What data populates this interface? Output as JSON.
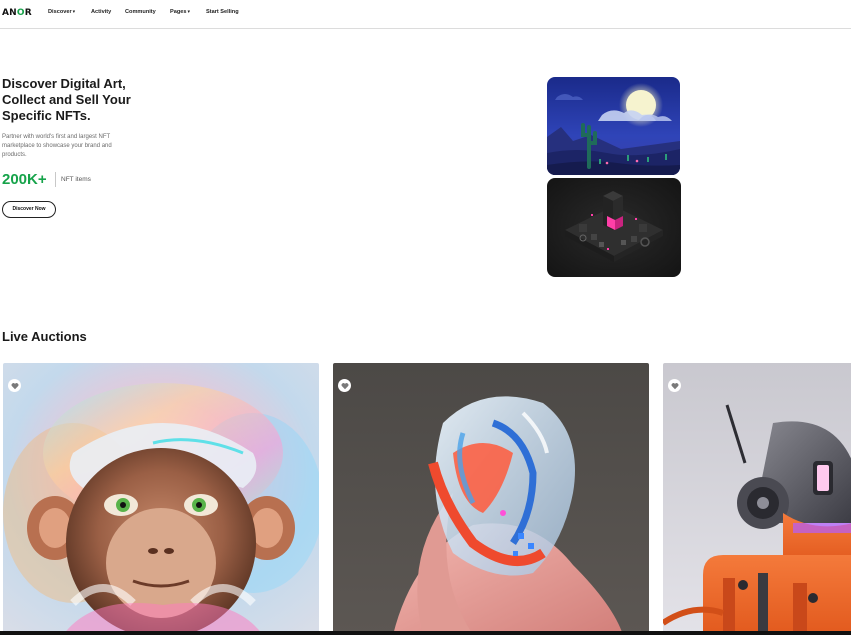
{
  "brand": {
    "logo_pre": "AN",
    "logo_o": "O",
    "logo_post": "R",
    "accent": "#16a34a"
  },
  "nav": {
    "items": [
      {
        "label": "Discover",
        "dropdown": true
      },
      {
        "label": "Activity",
        "dropdown": false
      },
      {
        "label": "Community",
        "dropdown": false
      },
      {
        "label": "Pages",
        "dropdown": true
      },
      {
        "label": "Start Selling",
        "dropdown": false
      }
    ]
  },
  "hero": {
    "title": "Discover Digital Art, Collect and Sell Your Specific NFTs.",
    "description": "Partner with world's first and largest NFT marketplace to showcase your brand and products.",
    "stat_value": "200K+",
    "stat_label": "NFT items",
    "cta_label": "Discover Now",
    "images": [
      "desert-moon-artwork",
      "isometric-city-artwork"
    ]
  },
  "auctions": {
    "title": "Live Auctions",
    "cards": [
      {
        "artwork": "holographic-monkey-artwork",
        "like_icon": "heart-icon"
      },
      {
        "artwork": "glass-helmet-figure-artwork",
        "like_icon": "heart-icon"
      },
      {
        "artwork": "robot-headset-artwork",
        "like_icon": "heart-icon"
      }
    ]
  }
}
